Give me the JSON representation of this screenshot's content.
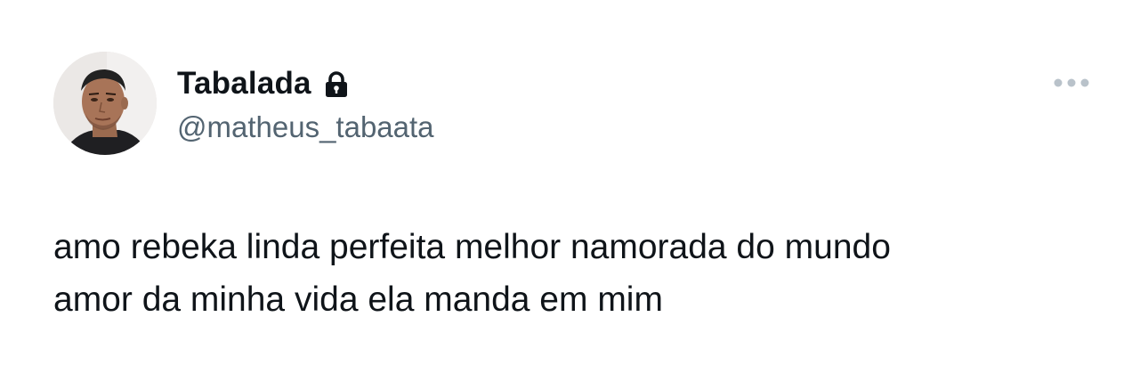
{
  "author": {
    "display_name": "Tabalada",
    "handle": "@matheus_tabaata",
    "protected_icon": "lock-icon",
    "avatar_icon": "profile-photo"
  },
  "actions": {
    "more_icon": "more-horizontal-icon"
  },
  "tweet": {
    "lines": [
      "amo rebeka linda perfeita melhor namorada do mundo",
      "amor da minha vida ela manda em mim"
    ]
  },
  "colors": {
    "text_primary": "#0f1419",
    "text_secondary": "#536471",
    "more_dots": "#b9c2ca",
    "background": "#ffffff"
  }
}
